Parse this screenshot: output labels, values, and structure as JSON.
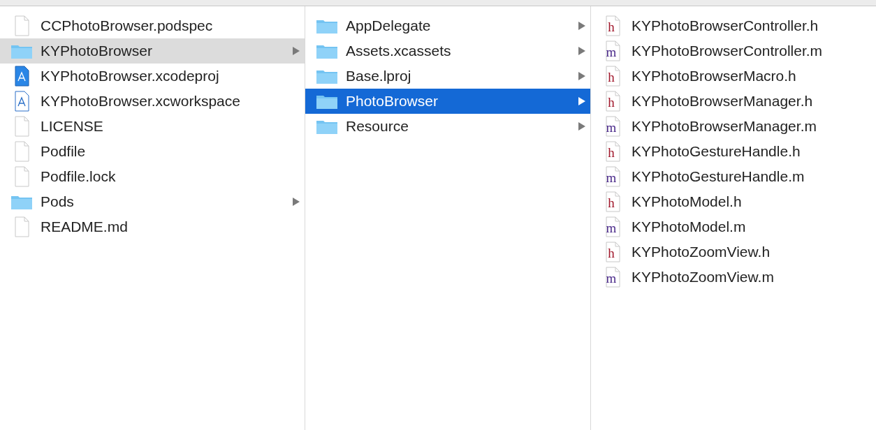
{
  "columns": [
    {
      "focused": false,
      "items": [
        {
          "name": "CCPhotoBrowser.podspec",
          "kind": "file",
          "selected": false
        },
        {
          "name": "KYPhotoBrowser",
          "kind": "folder",
          "selected": true
        },
        {
          "name": "KYPhotoBrowser.xcodeproj",
          "kind": "xcodeproj",
          "selected": false
        },
        {
          "name": "KYPhotoBrowser.xcworkspace",
          "kind": "xcworkspace",
          "selected": false
        },
        {
          "name": "LICENSE",
          "kind": "file",
          "selected": false
        },
        {
          "name": "Podfile",
          "kind": "file",
          "selected": false
        },
        {
          "name": "Podfile.lock",
          "kind": "file",
          "selected": false
        },
        {
          "name": "Pods",
          "kind": "folder",
          "selected": false
        },
        {
          "name": "README.md",
          "kind": "file",
          "selected": false
        }
      ]
    },
    {
      "focused": true,
      "items": [
        {
          "name": "AppDelegate",
          "kind": "folder",
          "selected": false
        },
        {
          "name": "Assets.xcassets",
          "kind": "folder",
          "selected": false
        },
        {
          "name": "Base.lproj",
          "kind": "folder",
          "selected": false
        },
        {
          "name": "PhotoBrowser",
          "kind": "folder",
          "selected": true
        },
        {
          "name": "Resource",
          "kind": "folder",
          "selected": false
        }
      ]
    },
    {
      "items": [
        {
          "name": "KYPhotoBrowserController.h",
          "kind": "source",
          "badge": "h",
          "selected": false
        },
        {
          "name": "KYPhotoBrowserController.m",
          "kind": "source",
          "badge": "m",
          "selected": false
        },
        {
          "name": "KYPhotoBrowserMacro.h",
          "kind": "source",
          "badge": "h",
          "selected": false
        },
        {
          "name": "KYPhotoBrowserManager.h",
          "kind": "source",
          "badge": "h",
          "selected": false
        },
        {
          "name": "KYPhotoBrowserManager.m",
          "kind": "source",
          "badge": "m",
          "selected": false
        },
        {
          "name": "KYPhotoGestureHandle.h",
          "kind": "source",
          "badge": "h",
          "selected": false
        },
        {
          "name": "KYPhotoGestureHandle.m",
          "kind": "source",
          "badge": "m",
          "selected": false
        },
        {
          "name": "KYPhotoModel.h",
          "kind": "source",
          "badge": "h",
          "selected": false
        },
        {
          "name": "KYPhotoModel.m",
          "kind": "source",
          "badge": "m",
          "selected": false
        },
        {
          "name": "KYPhotoZoomView.h",
          "kind": "source",
          "badge": "h",
          "selected": false
        },
        {
          "name": "KYPhotoZoomView.m",
          "kind": "source",
          "badge": "m",
          "selected": false
        }
      ]
    }
  ]
}
